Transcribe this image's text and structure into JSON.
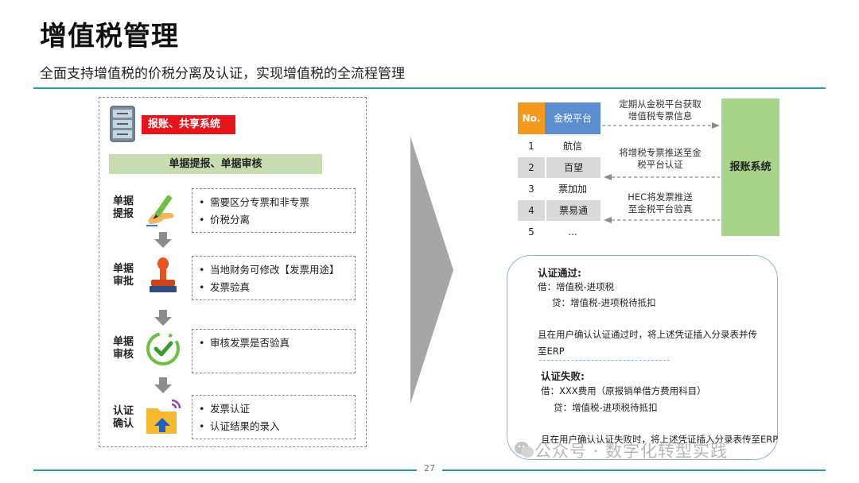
{
  "header": {
    "title": "增值税管理",
    "subtitle": "全面支持增值税的价税分离及认证，实现增值税的全流程管理"
  },
  "left_panel": {
    "system_badge": "报账、共享系统",
    "stage_bar": "单据提报、单据审核",
    "steps": [
      {
        "label_line1": "单据",
        "label_line2": "提报",
        "icon": "pen-hand-icon",
        "bullets": [
          "需要区分专票和非专票",
          "价税分离"
        ]
      },
      {
        "label_line1": "单据",
        "label_line2": "审批",
        "icon": "stamp-icon",
        "bullets": [
          "当地财务可修改【发票用途】",
          "发票验真"
        ]
      },
      {
        "label_line1": "单据",
        "label_line2": "审核",
        "icon": "check-circle-icon",
        "bullets": [
          "审核发票是否验真"
        ]
      },
      {
        "label_line1": "认证",
        "label_line2": "确认",
        "icon": "folder-upload-icon",
        "bullets": [
          "发票认证",
          "认证结果的录入"
        ]
      }
    ]
  },
  "platform_table": {
    "header_no": "No.",
    "header_name": "金税平台",
    "rows": [
      {
        "no": "1",
        "name": "航信"
      },
      {
        "no": "2",
        "name": "百望"
      },
      {
        "no": "3",
        "name": "票加加"
      },
      {
        "no": "4",
        "name": "票易通"
      },
      {
        "no": "5",
        "name": "..."
      }
    ]
  },
  "flows": {
    "flow1_line1": "定期从金税平台获取",
    "flow1_line2": "增值税专票信息",
    "flow2_line1": "将增税专票推送至金",
    "flow2_line2": "税平台认证",
    "flow3_line1": "HEC将发票推送",
    "flow3_line2": "至金税平台验真"
  },
  "receiver": {
    "label": "报账系统"
  },
  "accounting": {
    "pass_title": "认证通过:",
    "pass_debit": "借：增值税-进项税",
    "pass_credit": "贷：增值税-进项税待抵扣",
    "pass_note_line1": "且在用户确认认证通过时，将上述凭证插入分录表并传",
    "pass_note_line2": "至ERP",
    "fail_title": "认证失败:",
    "fail_debit": "借：XXX费用（原报销单借方费用科目）",
    "fail_credit": "贷：增值税-进项税待抵扣",
    "fail_note": "且在用户确认认证失败时，将上述凭证插入分录表传至ERP"
  },
  "footer": {
    "page_number": "27"
  },
  "watermark": {
    "text": "公众号 · 数字化转型实践"
  },
  "colors": {
    "accent_teal": "#2a9a9a",
    "badge_red": "#e8141b",
    "stage_green": "#c7dcb0",
    "no_orange": "#f39a1e",
    "platform_blue": "#5a8ed1",
    "receiver_green": "#a8d48a"
  }
}
